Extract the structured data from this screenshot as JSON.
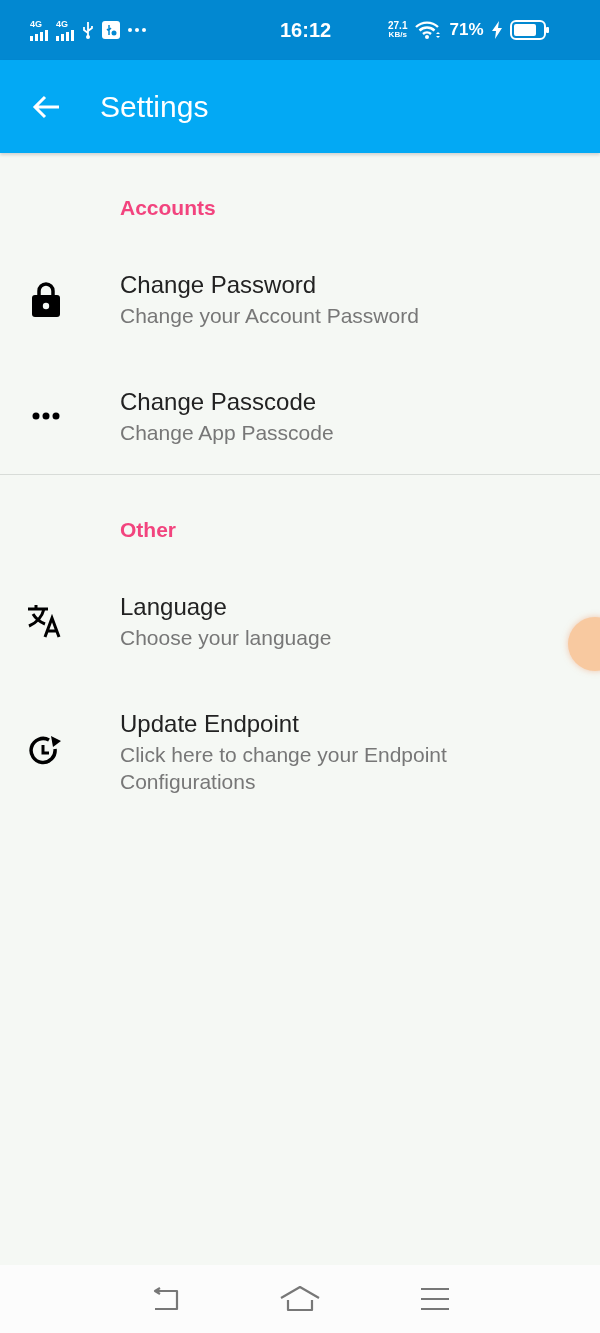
{
  "status_bar": {
    "network_1": "4G",
    "network_2": "4G",
    "time": "16:12",
    "speed_value": "27.1",
    "speed_unit": "KB/s",
    "battery": "71%",
    "charging": true
  },
  "app_bar": {
    "title": "Settings"
  },
  "sections": [
    {
      "header": "Accounts",
      "items": [
        {
          "kind": "lock",
          "title": "Change Password",
          "subtitle": "Change your Account Password"
        },
        {
          "kind": "dots",
          "title": "Change Passcode",
          "subtitle": "Change App Passcode"
        }
      ]
    },
    {
      "header": "Other",
      "items": [
        {
          "kind": "translate",
          "title": "Language",
          "subtitle": "Choose your language"
        },
        {
          "kind": "clock",
          "title": "Update Endpoint",
          "subtitle": "Click here to change your Endpoint Configurations"
        }
      ]
    }
  ]
}
